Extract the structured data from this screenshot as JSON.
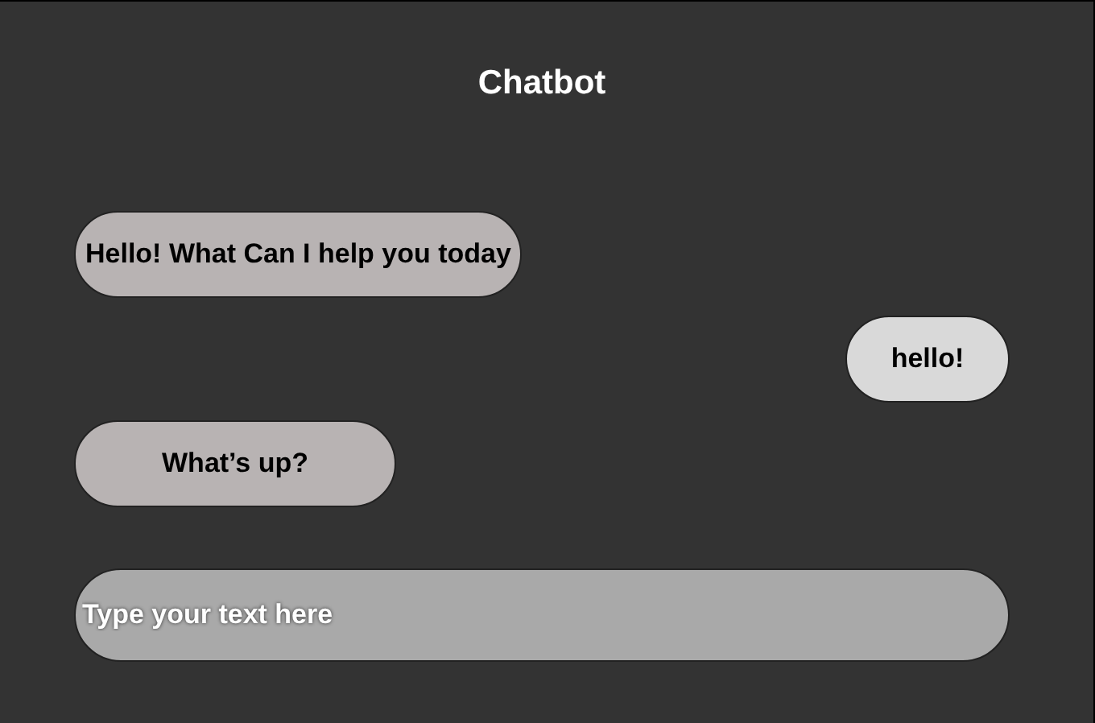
{
  "title": "Chatbot",
  "messages": [
    {
      "kind": "bot",
      "text": "Hello! What Can I help you today"
    },
    {
      "kind": "user",
      "text": "hello!"
    },
    {
      "kind": "bot",
      "text": "What’s up?"
    }
  ],
  "input": {
    "placeholder": "Type your text here"
  }
}
